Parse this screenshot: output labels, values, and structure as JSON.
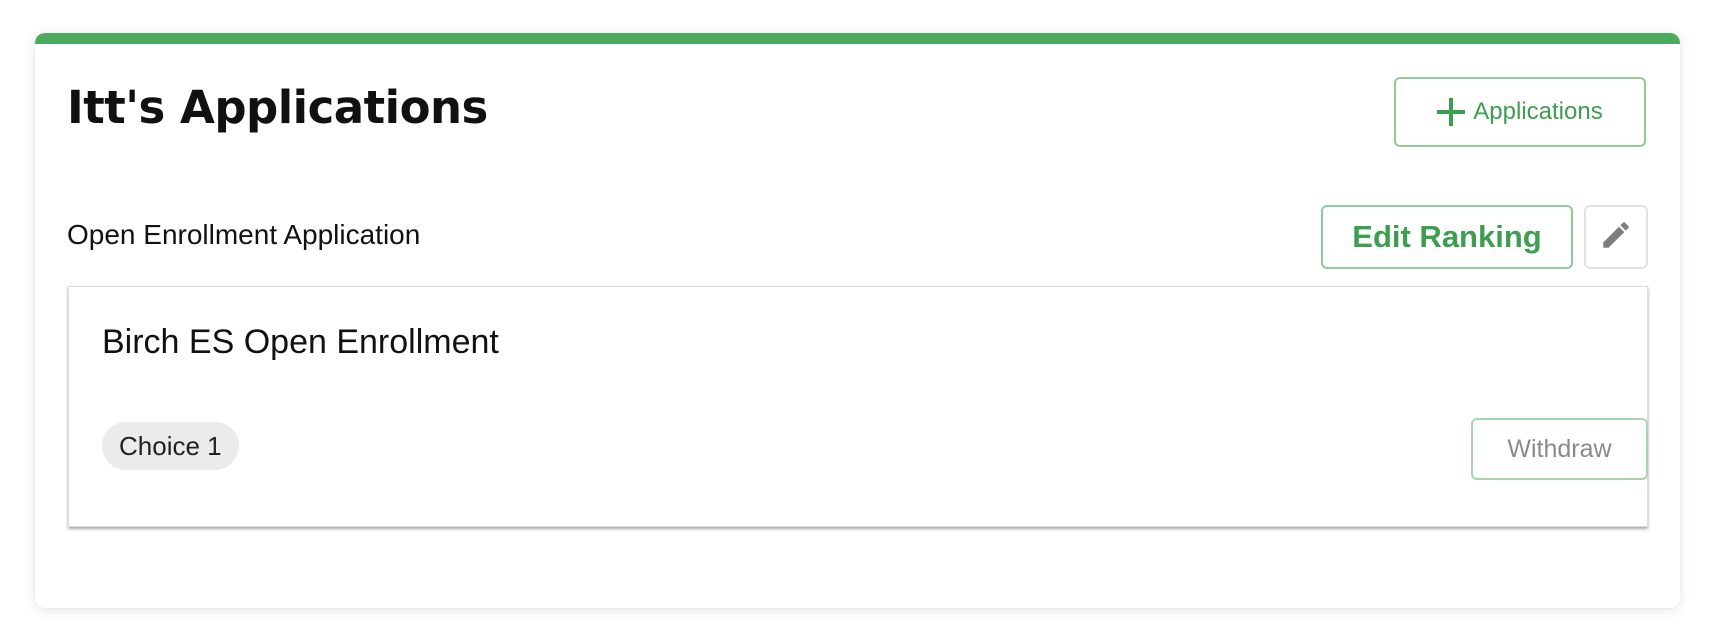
{
  "header": {
    "title": "Itt's Applications",
    "add_button_label": "Applications",
    "add_button_icon": "plus-icon",
    "accent_color": "#4caa5e"
  },
  "section": {
    "title": "Open Enrollment Application",
    "edit_ranking_label": "Edit Ranking",
    "edit_icon": "pencil-icon"
  },
  "applications": [
    {
      "name": "Birch ES Open Enrollment",
      "choice_label": "Choice 1",
      "withdraw_label": "Withdraw"
    }
  ]
}
